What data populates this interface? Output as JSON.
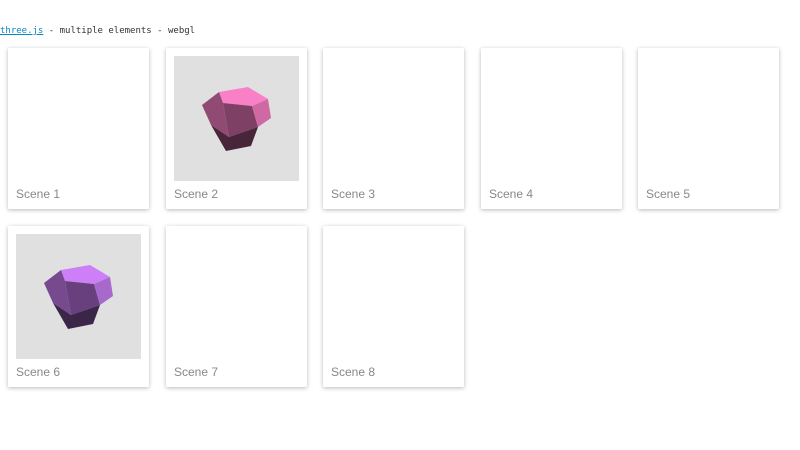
{
  "header": {
    "link_text": "three.js",
    "suffix_text": " - multiple elements - webgl"
  },
  "scenes": [
    {
      "label": "Scene 1",
      "rendered": false
    },
    {
      "label": "Scene 2",
      "rendered": true,
      "color": "#f27cc1"
    },
    {
      "label": "Scene 3",
      "rendered": false
    },
    {
      "label": "Scene 4",
      "rendered": false
    },
    {
      "label": "Scene 5",
      "rendered": false
    },
    {
      "label": "Scene 6",
      "rendered": true,
      "color": "#c67bf0"
    },
    {
      "label": "Scene 7",
      "rendered": false
    },
    {
      "label": "Scene 8",
      "rendered": false
    }
  ],
  "colors": {
    "scene_background": "#e0e0e0",
    "label_text": "#888888",
    "link": "#0b88c4"
  },
  "icons": {
    "shape": "dodecahedron-icon"
  }
}
